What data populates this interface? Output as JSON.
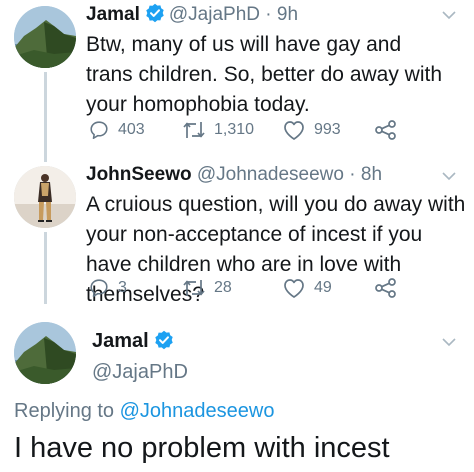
{
  "tweet1": {
    "name": "Jamal",
    "handle": "@JajaPhD",
    "time": "· 9h",
    "text": "Btw, many of us will have gay and trans children. So, better do away with your homophobia today.",
    "replies": "403",
    "retweets": "1,310",
    "likes": "993"
  },
  "tweet2": {
    "name": "JohnSeewo",
    "handle": "@Johnadeseewo",
    "time": "· 8h",
    "text": "A cruious question, will you do away with your non-acceptance of incest if you have children who are in love with themselves?",
    "replies": "3",
    "retweets": "28",
    "likes": "49"
  },
  "main_tweet": {
    "name": "Jamal",
    "handle": "@JajaPhD",
    "replying_prefix": "Replying to",
    "replying_to": "@Johnadeseewo",
    "text": "I have no problem with incest"
  },
  "colors": {
    "verified": "#1da1f2",
    "link": "#1b95e0",
    "muted": "#657786",
    "thread_line": "#ccd6dd"
  },
  "icons": [
    "verified-badge-icon",
    "chevron-down-icon",
    "reply-icon",
    "retweet-icon",
    "like-icon",
    "share-icon"
  ]
}
